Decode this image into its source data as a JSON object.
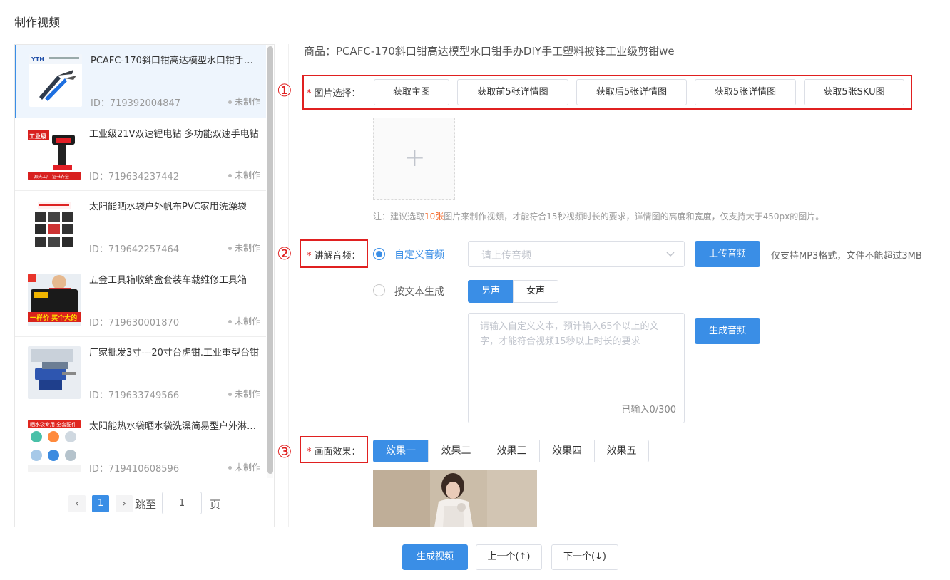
{
  "page_title": "制作视频",
  "products": [
    {
      "title": "PCAFC-170斜口钳高达模型水口钳手办DIY手工塑料披锋工业级剪钳we",
      "id_text": "ID：719392004847",
      "status": "未制作",
      "active": true
    },
    {
      "title": "工业级21V双速锂电钻 多功能双速手电钻",
      "id_text": "ID：719634237442",
      "status": "未制作"
    },
    {
      "title": "太阳能晒水袋户外帆布PVC家用洗澡袋",
      "id_text": "ID：719642257464",
      "status": "未制作"
    },
    {
      "title": "五金工具箱收纳盒套装车载维修工具箱",
      "id_text": "ID：719630001870",
      "status": "未制作"
    },
    {
      "title": "厂家批发3寸---20寸台虎钳.工业重型台钳",
      "id_text": "ID：719633749566",
      "status": "未制作"
    },
    {
      "title": "太阳能热水袋晒水袋洗澡简易型户外淋浴袋",
      "id_text": "ID：719410608596",
      "status": "未制作"
    }
  ],
  "thumb_texts": {
    "t1": "YTH",
    "t2a": "工业级",
    "t2b": "源头工厂 证书齐全",
    "t4": "一样价 买个大的",
    "t6": "晒水袋专用 全套配件"
  },
  "pagination": {
    "prev": "‹",
    "current": "1",
    "next": "›",
    "jump_label": "跳至",
    "jump_value": "1",
    "page_label": "页"
  },
  "product_line": "商品：PCAFC-170斜口钳高达模型水口钳手办DIY手工塑料披锋工业级剪钳we",
  "markers": {
    "m1": "①",
    "m2": "②",
    "m3": "③"
  },
  "image_section": {
    "star": "*",
    "label": "图片选择：",
    "buttons": [
      "获取主图",
      "获取前5张详情图",
      "获取后5张详情图",
      "获取5张详情图",
      "获取5张SKU图"
    ],
    "plus": "+",
    "note_prefix": "注：建议选取",
    "note_highlight": "10张",
    "note_suffix": "图片来制作视频，才能符合15秒视频时长的要求，详情图的高度和宽度，仅支持大于450px的图片。"
  },
  "audio_section": {
    "star": "*",
    "label": "讲解音频：",
    "custom_label": "自定义音频",
    "select_placeholder": "请上传音频",
    "upload_button": "上传音频",
    "upload_hint": "仅支持MP3格式，文件不能超过3MB",
    "text_label": "按文本生成",
    "voice_male": "男声",
    "voice_female": "女声",
    "textarea_placeholder": "请输入自定义文本，预计输入65个以上的文字，才能符合视频15秒以上时长的要求",
    "char_count": "已输入0/300",
    "generate_button": "生成音频"
  },
  "effect_section": {
    "star": "*",
    "label": "画面效果：",
    "options": [
      "效果一",
      "效果二",
      "效果三",
      "效果四",
      "效果五"
    ]
  },
  "footer": {
    "generate": "生成视频",
    "prev": "上一个(↑)",
    "next": "下一个(↓)"
  },
  "colors": {
    "primary": "#3a8ee6",
    "annotation_red": "#e02020",
    "highlight_orange": "#f56c2d"
  }
}
